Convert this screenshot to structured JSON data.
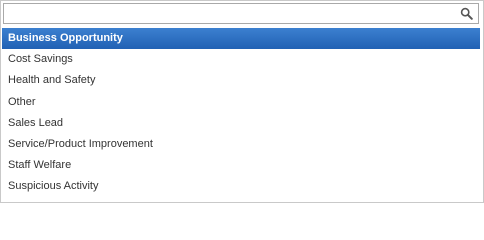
{
  "search": {
    "value": "",
    "placeholder": "",
    "icon": "search-icon"
  },
  "options": [
    {
      "label": "Business Opportunity",
      "selected": true
    },
    {
      "label": "Cost Savings",
      "selected": false
    },
    {
      "label": "Health and Safety",
      "selected": false
    },
    {
      "label": "Other",
      "selected": false
    },
    {
      "label": "Sales Lead",
      "selected": false
    },
    {
      "label": "Service/Product Improvement",
      "selected": false
    },
    {
      "label": "Staff Welfare",
      "selected": false
    },
    {
      "label": "Suspicious Activity",
      "selected": false
    }
  ],
  "colors": {
    "highlight": "#2a6ebf",
    "text": "#333333",
    "border": "#c9c9c9"
  }
}
